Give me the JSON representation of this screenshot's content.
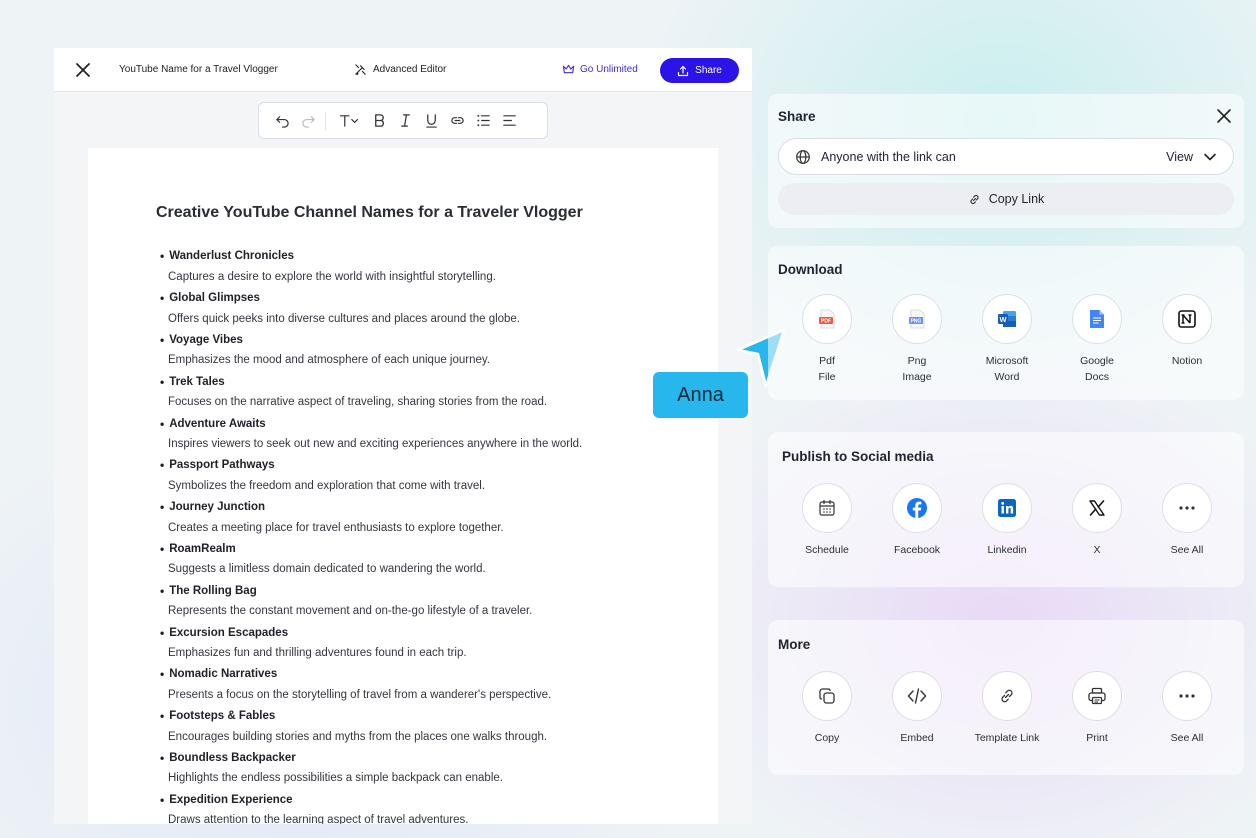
{
  "editor": {
    "doc_title": "YouTube Name for a Travel Vlogger",
    "advanced_editor": "Advanced Editor",
    "go_unlimited": "Go Unlimited",
    "share": "Share"
  },
  "document": {
    "heading": "Creative YouTube Channel Names for a Traveler Vlogger",
    "items": [
      {
        "name": "Wanderlust Chronicles",
        "desc": "Captures a desire to explore the world with insightful storytelling."
      },
      {
        "name": "Global Glimpses",
        "desc": "Offers quick peeks into diverse cultures and places around the globe."
      },
      {
        "name": "Voyage Vibes",
        "desc": "Emphasizes the mood and atmosphere of each unique journey."
      },
      {
        "name": "Trek Tales",
        "desc": "Focuses on the narrative aspect of traveling, sharing stories from the road."
      },
      {
        "name": "Adventure Awaits",
        "desc": "Inspires viewers to seek out new and exciting experiences anywhere in the world."
      },
      {
        "name": "Passport Pathways",
        "desc": "Symbolizes the freedom and exploration that come with travel."
      },
      {
        "name": "Journey Junction",
        "desc": "Creates a meeting place for travel enthusiasts to explore together."
      },
      {
        "name": "RoamRealm",
        "desc": "Suggests a limitless domain dedicated to wandering the world."
      },
      {
        "name": "The Rolling Bag",
        "desc": "Represents the constant movement and on-the-go lifestyle of a traveler."
      },
      {
        "name": "Excursion Escapades",
        "desc": "Emphasizes fun and thrilling adventures found in each trip."
      },
      {
        "name": "Nomadic Narratives",
        "desc": "Presents a focus on the storytelling of travel from a wanderer's perspective."
      },
      {
        "name": "Footsteps & Fables",
        "desc": "Encourages building stories and myths from the places one walks through."
      },
      {
        "name": "Boundless Backpacker",
        "desc": "Highlights the endless possibilities a simple backpack can enable."
      },
      {
        "name": "Expedition Experience",
        "desc": "Draws attention to the learning aspect of travel adventures."
      }
    ]
  },
  "cursor_label": "Anna",
  "share_panel": {
    "title": "Share",
    "link_access": "Anyone with the link can",
    "permission": "View",
    "copy_link": "Copy Link"
  },
  "download_panel": {
    "title": "Download",
    "options": [
      {
        "label": "Pdf\nFile",
        "icon": "pdf-file-icon"
      },
      {
        "label": "Png\nImage",
        "icon": "png-image-icon"
      },
      {
        "label": "Microsoft\nWord",
        "icon": "microsoft-word-icon"
      },
      {
        "label": "Google\nDocs",
        "icon": "google-docs-icon"
      },
      {
        "label": "Notion",
        "icon": "notion-icon"
      }
    ]
  },
  "social_panel": {
    "title": "Publish to Social media",
    "options": [
      {
        "label": "Schedule",
        "icon": "calendar-icon"
      },
      {
        "label": "Facebook",
        "icon": "facebook-icon"
      },
      {
        "label": "Linkedin",
        "icon": "linkedin-icon"
      },
      {
        "label": "X",
        "icon": "x-logo-icon"
      },
      {
        "label": "See All",
        "icon": "more-icon"
      }
    ]
  },
  "more_panel": {
    "title": "More",
    "options": [
      {
        "label": "Copy",
        "icon": "copy-icon"
      },
      {
        "label": "Embed",
        "icon": "code-icon"
      },
      {
        "label": "Template Link",
        "icon": "link-icon"
      },
      {
        "label": "Print",
        "icon": "printer-icon"
      },
      {
        "label": "See All",
        "icon": "more-icon"
      }
    ]
  },
  "colors": {
    "primary": "#2c14e8",
    "cursor": "#27b7ec",
    "facebook": "#1877f2",
    "linkedin": "#0a66c2"
  }
}
